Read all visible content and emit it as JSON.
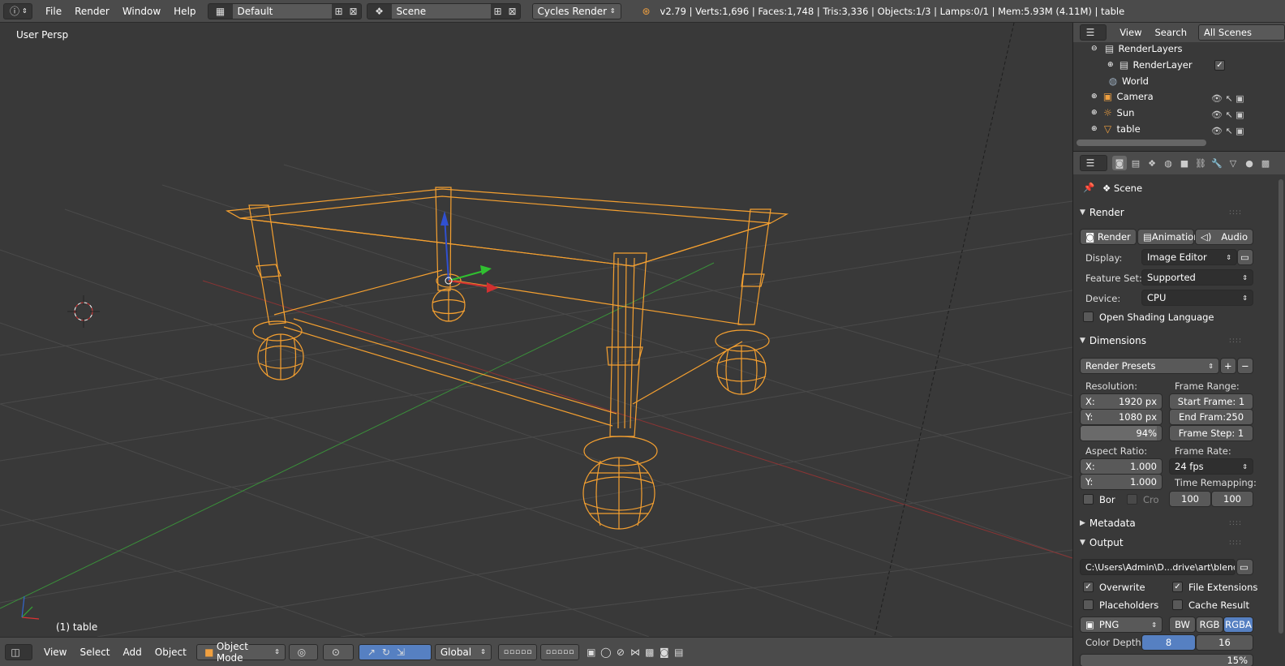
{
  "topbar": {
    "menus": [
      "File",
      "Render",
      "Window",
      "Help"
    ],
    "layout": "Default",
    "scene": "Scene",
    "engine": "Cycles Render",
    "stats": "v2.79 | Verts:1,696 | Faces:1,748 | Tris:3,336 | Objects:1/3 | Lamps:0/1 | Mem:5.93M (4.11M) | table"
  },
  "viewport": {
    "view_label": "User Persp",
    "object_label": "(1) table",
    "wire_color": "#f5a030",
    "axis_x_color": "#b33a3a",
    "axis_y_color": "#3a8f3a"
  },
  "bottombar": {
    "menus": [
      "View",
      "Select",
      "Add",
      "Object"
    ],
    "mode": "Object Mode",
    "orientation": "Global"
  },
  "outliner": {
    "tabs": [
      "View",
      "Search",
      "All Scenes"
    ],
    "items": [
      {
        "label": "RenderLayers",
        "icon": "render-layers-icon"
      },
      {
        "label": "RenderLayer",
        "icon": "render-layer-icon"
      },
      {
        "label": "World",
        "icon": "world-icon"
      },
      {
        "label": "Camera",
        "icon": "camera-icon"
      },
      {
        "label": "Sun",
        "icon": "sun-icon"
      },
      {
        "label": "table",
        "icon": "mesh-icon"
      }
    ]
  },
  "properties": {
    "context": "Scene",
    "render_section": "Render",
    "render_buttons": [
      "Render",
      "Animation",
      "Audio"
    ],
    "display_label": "Display:",
    "display_value": "Image Editor",
    "feature_label": "Feature Set:",
    "feature_value": "Supported",
    "device_label": "Device:",
    "device_value": "CPU",
    "osl_label": "Open Shading Language",
    "dimensions_section": "Dimensions",
    "presets": "Render Presets",
    "resolution_label": "Resolution:",
    "res_x_label": "X:",
    "res_x": "1920 px",
    "res_y_label": "Y:",
    "res_y": "1080 px",
    "res_pct": "94%",
    "frame_range_label": "Frame Range:",
    "start_frame": "Start Frame: 1",
    "end_frame": "End Fram:250",
    "frame_step": "Frame Step: 1",
    "aspect_label": "Aspect Ratio:",
    "aspect_x_label": "X:",
    "aspect_x": "1.000",
    "aspect_y_label": "Y:",
    "aspect_y": "1.000",
    "frame_rate_label": "Frame Rate:",
    "frame_rate": "24 fps",
    "time_remap_label": "Time Remapping:",
    "remap_old": "100",
    "remap_new": "100",
    "border_label": "Bor",
    "crop_label": "Cro",
    "metadata_section": "Metadata",
    "output_section": "Output",
    "output_path": "C:\\Users\\Admin\\D...drive\\art\\blender\\",
    "overwrite": "Overwrite",
    "file_ext": "File Extensions",
    "placeholders": "Placeholders",
    "cache_result": "Cache Result",
    "format": "PNG",
    "color_modes": [
      "BW",
      "RGB",
      "RGBA"
    ],
    "color_depth_label": "Color Depth:",
    "depths": [
      "8",
      "16"
    ],
    "compression_partial": "15%"
  }
}
